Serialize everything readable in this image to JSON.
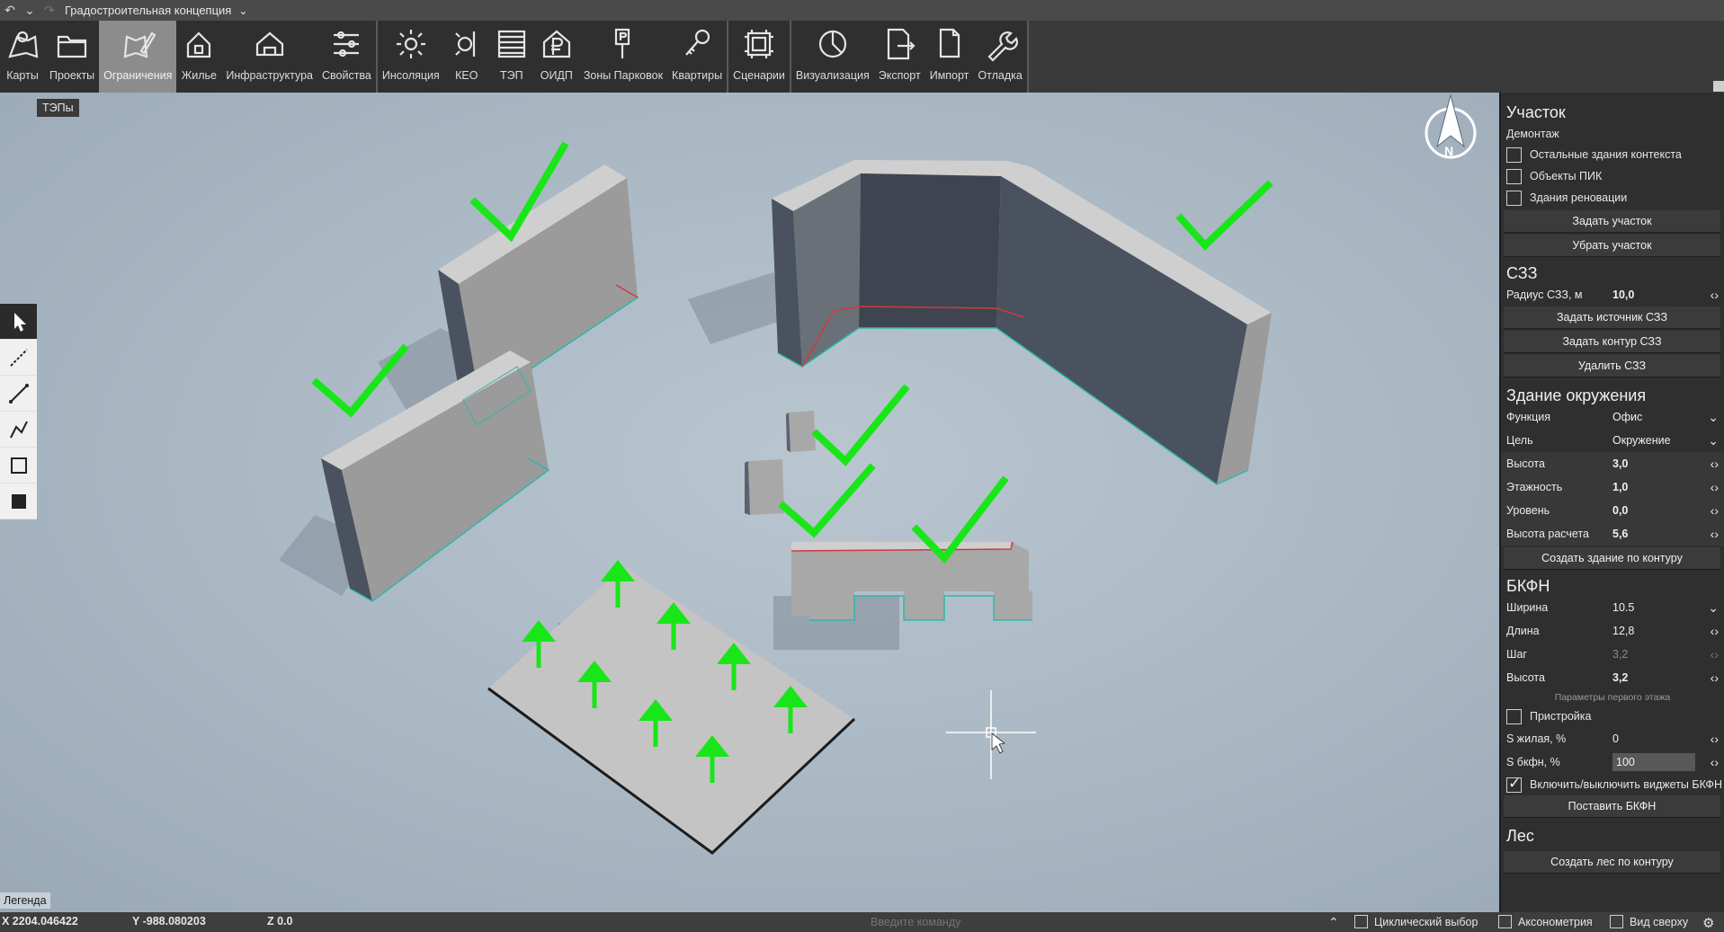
{
  "titlebar": {
    "title": "Градостроительная концепция"
  },
  "toolbar": {
    "tools": [
      {
        "label": "Карты",
        "icon": "map-pin-icon"
      },
      {
        "label": "Проекты",
        "icon": "folder-icon"
      },
      {
        "label": "Ограничения",
        "icon": "map-edit-icon",
        "active": true
      },
      {
        "label": "Жилье",
        "icon": "house-icon"
      },
      {
        "label": "Инфраструктура",
        "icon": "building-icon"
      },
      {
        "label": "Свойства",
        "icon": "sliders-icon"
      },
      {
        "label": "Инсоляция",
        "icon": "sun-icon"
      },
      {
        "label": "КЕО",
        "icon": "light-icon"
      },
      {
        "label": "ТЭП",
        "icon": "table-icon"
      },
      {
        "label": "ОИДП",
        "icon": "ruble-house-icon"
      },
      {
        "label": "Зоны Парковок",
        "icon": "parking-icon"
      },
      {
        "label": "Квартиры",
        "icon": "key-icon"
      },
      {
        "label": "Сценарии",
        "icon": "scenario-icon"
      },
      {
        "label": "Визуализация",
        "icon": "pie-icon"
      },
      {
        "label": "Экспорт",
        "icon": "export-icon"
      },
      {
        "label": "Импорт",
        "icon": "import-icon"
      },
      {
        "label": "Отладка",
        "icon": "wrench-icon"
      }
    ]
  },
  "viewport": {
    "tep_label": "ТЭПы",
    "legend": "Легенда",
    "compass_letter": "N"
  },
  "status": {
    "x": "X 2204.046422",
    "y": "Y -988.080203",
    "z": "Z 0.0",
    "command_placeholder": "Введите команду",
    "cyclic": "Циклический выбор",
    "axon": "Аксонометрия",
    "top_view": "Вид сверху"
  },
  "panel": {
    "plot": {
      "title": "Участок",
      "demolition": "Демонтаж",
      "cb_context": "Остальные здания контекста",
      "cb_pik": "Объекты ПИК",
      "cb_renov": "Здания реновации",
      "btn_set": "Задать участок",
      "btn_remove": "Убрать участок"
    },
    "szz": {
      "title": "СЗЗ",
      "radius_label": "Радиус СЗЗ, м",
      "radius_value": "10,0",
      "btn_source": "Задать источник СЗЗ",
      "btn_contour": "Задать контур СЗЗ",
      "btn_delete": "Удалить СЗЗ"
    },
    "env": {
      "title": "Здание окружения",
      "function_label": "Функция",
      "function_value": "Офис",
      "goal_label": "Цель",
      "goal_value": "Окружение",
      "height_label": "Высота",
      "height_value": "3,0",
      "floors_label": "Этажность",
      "floors_value": "1,0",
      "level_label": "Уровень",
      "level_value": "0,0",
      "calc_height_label": "Высота расчета",
      "calc_height_value": "5,6",
      "btn_create": "Создать здание по контуру"
    },
    "bkfn": {
      "title": "БКФН",
      "width_label": "Ширина",
      "width_value": "10.5",
      "length_label": "Длина",
      "length_value": "12,8",
      "step_label": "Шаг",
      "step_value": "3,2",
      "height_label": "Высота",
      "height_value": "3,2",
      "first_floor_note": "Параметры первого этажа",
      "cb_annex": "Пристройка",
      "s_living_label": "S жилая, %",
      "s_living_value": "0",
      "s_bkfn_label": "S бкфн, %",
      "s_bkfn_value": "100",
      "cb_widgets": "Включить/выключить виджеты БКФН",
      "btn_place": "Поставить БКФН"
    },
    "forest": {
      "title": "Лес",
      "btn_create": "Создать лес по контуру"
    }
  },
  "colors": {
    "accent_green": "#19e619",
    "active_tab": "#8c8c8c",
    "panel_bg": "#2f2f2f"
  }
}
